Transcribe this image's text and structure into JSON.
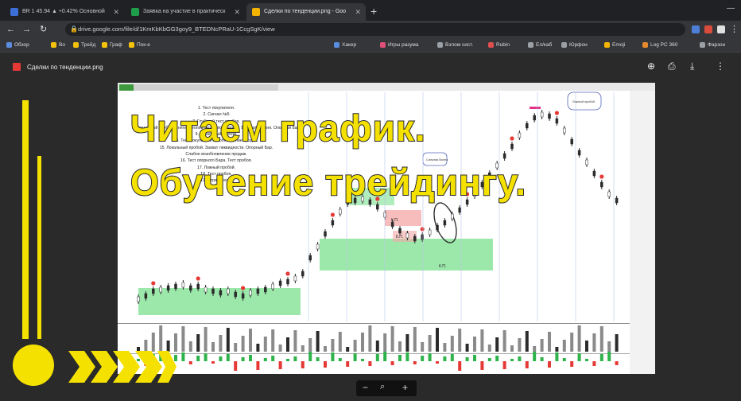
{
  "tabs": [
    {
      "label": "BR 1 45.94 ▲ +0.42% Основной",
      "fav": "#3c6fd8"
    },
    {
      "label": "Заявка на участие в практическ",
      "fav": "#1e9e4a"
    },
    {
      "label": "Сделки по тенденции.png - Goo",
      "fav": "#f4b400"
    }
  ],
  "address": "drive.google.com/file/d/1KmKbKbGG3goy9_BTEDNcPRaU-1CcgSgK/view",
  "bookmarks": [
    "Обзор",
    "Во",
    "Трейд",
    "Граф",
    "Пок-е",
    "Хакер",
    "Игры разума",
    "Взлом сист.",
    "Rubin",
    "Ел/каб",
    "Юрфон",
    "Emoji",
    "Log PC 360",
    "Фарзон"
  ],
  "viewer": {
    "file_name": "Сделки по тенденции.png"
  },
  "headline": {
    "line1": "Читаем график.",
    "line2": "Обучение трейдингу."
  },
  "chart_list": [
    "1. Тест покупателя.",
    "2. Сигнал №5",
    "",
    "",
    "",
    "",
    "7. Глубокий тест пробоя.",
    "8. Локальный пробой. Снятие стопов. Атака покупателя. Возврат уровня. Опорный Бар.",
    "9. Локальный пробой.",
    "",
    "",
    "",
    "",
    "14. Тест покупателя возобновление продаж.",
    "15. Локальный пробой. Захват ликвидности. Опорный Бар.",
    "Слабое возобновление продаж.",
    "16. Тест опорного Бара. Тест пробоя.",
    "17. Ложный пробой.",
    "18. Тест пробоя.",
    "19. Стринг тесть"
  ],
  "chart_labels": {
    "box1": "К.П.",
    "box2": "К.П.",
    "box3": "К.П.",
    "note1": "Сильная Волна",
    "note2": "Ложный пробой"
  },
  "colors": {
    "accent": "#f5e100",
    "zone_green": "#7be08f",
    "zone_red": "#f4a6a6",
    "candle": "#2b2b2b"
  }
}
